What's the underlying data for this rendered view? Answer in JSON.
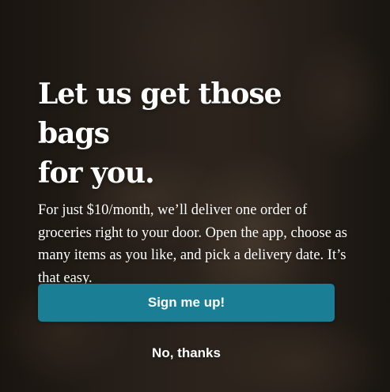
{
  "modal": {
    "headline_line1": "Let us get those bags",
    "headline_line2": "for you.",
    "body": "For just $10/month, we’ll deliver one order of groceries right to your door. Open the app, choose as many items as you like, and pick a delivery date. It’s that easy.",
    "cta_label": "Sign me up!",
    "decline_label": "No, thanks"
  },
  "colors": {
    "button": "#1a7e95",
    "text": "#ffffff",
    "overlay": "#14100c"
  }
}
